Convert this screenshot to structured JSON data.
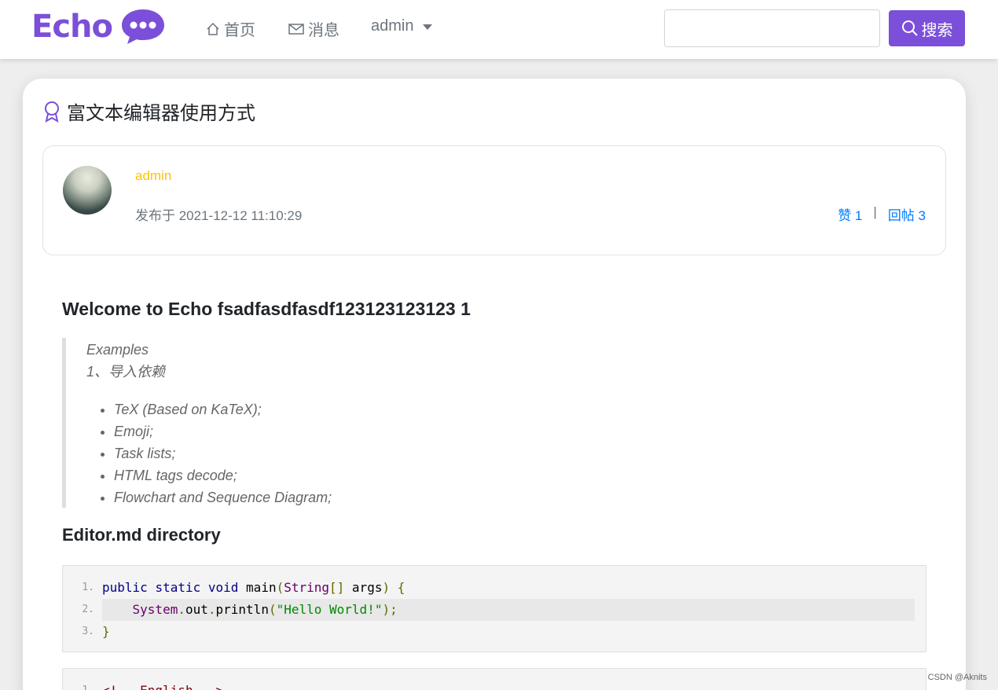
{
  "navbar": {
    "brand": "Echo",
    "home_label": "首页",
    "messages_label": "消息",
    "user_label": "admin",
    "search_value": "",
    "search_button": "搜索"
  },
  "post": {
    "title": "富文本编辑器使用方式",
    "author": "admin",
    "date": "发布于 2021-12-12 11:10:29",
    "likes": "赞 1",
    "divider": "|",
    "replies": "回帖 3"
  },
  "content": {
    "heading": "Welcome to Echo fsadfasdfasdf123123123123 1",
    "quote_line1": "Examples",
    "quote_line2": "1、导入依赖",
    "list": [
      "TeX (Based on KaTeX);",
      "Emoji;",
      "Task lists;",
      "HTML tags decode;",
      "Flowchart and Sequence Diagram;"
    ],
    "subheading": "Editor.md directory",
    "code_line_numbers": [
      "1.",
      "2.",
      "3."
    ],
    "code2_line_number": "1."
  },
  "watermark": "CSDN @Aknits"
}
